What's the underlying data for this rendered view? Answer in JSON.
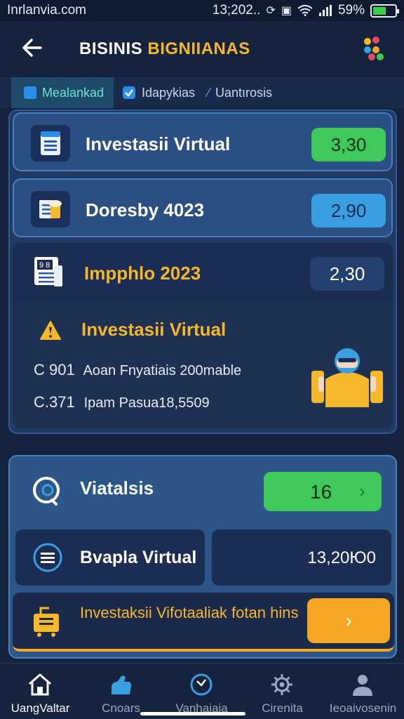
{
  "status_bar": {
    "carrier": "Inrlanvia.com",
    "time": "13;202..",
    "battery_text": "59%",
    "battery_level": 0.59,
    "icons": [
      "sync-icon",
      "nfc-icon",
      "wifi-icon",
      "signal-icon",
      "battery-icon"
    ]
  },
  "header": {
    "title_part1": "BISINIS",
    "title_part2": "BIGNIIANAS",
    "back_icon": "arrow-left-icon",
    "menu_icon": "colored-dots-menu-icon"
  },
  "tabs": [
    {
      "label": "Mealankad",
      "active": true
    },
    {
      "label": "Idapykias",
      "active": false
    },
    {
      "label": "Uantırosis",
      "active": false
    }
  ],
  "rows": [
    {
      "label": "Investasii Virtual",
      "value": "3,30",
      "style": "green",
      "icon": "document-list-icon"
    },
    {
      "label": "Doresby 4023",
      "value": "2,90",
      "style": "blue",
      "icon": "beer-document-icon"
    },
    {
      "label": "Impphlo 2023",
      "value": "2,30",
      "style": "dark",
      "icon": "report-icon"
    }
  ],
  "detail": {
    "title": "Investasii Virtual",
    "lines": [
      {
        "code": "C 901",
        "text": "Aoan Fnyatiais 200mable"
      },
      {
        "code": "C.371",
        "text": "Ipam Pasua18,5509"
      }
    ]
  },
  "summary": {
    "label": "Viatalsis",
    "value": "16",
    "sub_left_label": "Bvapla Virtual",
    "sub_right_value": "13,20Ю0",
    "promo_text": "Investaksii Vifotaaliak fotan hins"
  },
  "bottom_nav": [
    {
      "label": "UangValtar",
      "icon": "home-icon",
      "active": true
    },
    {
      "label": "Cnoars",
      "icon": "hand-icon",
      "active": false
    },
    {
      "label": "Vanhaiaia",
      "icon": "compass-icon",
      "active": false
    },
    {
      "label": "Cirenita",
      "icon": "gear-icon",
      "active": false
    },
    {
      "label": "Ieoaivosenin",
      "icon": "profile-icon",
      "active": false
    }
  ],
  "colors": {
    "accent_yellow": "#f5b82a",
    "green": "#3ec95a",
    "blue": "#3a9fe0",
    "orange": "#f5a623",
    "background": "#15233f"
  }
}
